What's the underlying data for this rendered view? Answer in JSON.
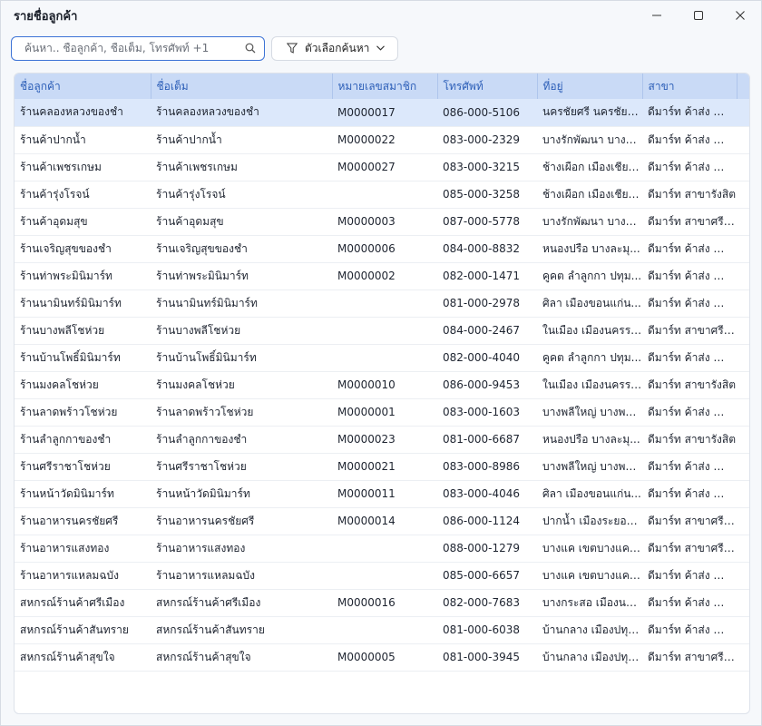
{
  "window": {
    "title": "รายชื่อลูกค้า",
    "controls": {
      "minimize": "—",
      "maximize": "☐",
      "close": "✕"
    }
  },
  "search": {
    "placeholder": "ค้นหา.. ชื่อลูกค้า, ชื่อเต็ม, โทรศัพท์ +1",
    "value": "",
    "icon": "search-icon"
  },
  "filter": {
    "label": "ตัวเลือกค้นหา",
    "icon": "funnel-icon",
    "chevron": "chevron-down-icon"
  },
  "colors": {
    "accent": "#3d73d6",
    "header_bg": "#c9daf6",
    "header_text": "#2d5fb8",
    "selected_row": "#dce8fb"
  },
  "table": {
    "columns": [
      "ชื่อลูกค้า",
      "ชื่อเต็ม",
      "หมายเลขสมาชิก",
      "โทรศัพท์",
      "ที่อยู่",
      "สาขา"
    ],
    "selected_index": 0,
    "rows": [
      [
        "ร้านคลองหลวงของชำ",
        "ร้านคลองหลวงของชำ",
        "M0000017",
        "086-000-5106",
        "นครชัยศรี นครชัยศ...",
        "ดีมาร์ท ค้าส่ง สำนั..."
      ],
      [
        "ร้านค้าปากน้ำ",
        "ร้านค้าปากน้ำ",
        "M0000022",
        "083-000-2329",
        "บางรักพัฒนา บางบั...",
        "ดีมาร์ท ค้าส่ง สำนั..."
      ],
      [
        "ร้านค้าเพชรเกษม",
        "ร้านค้าเพชรเกษม",
        "M0000027",
        "083-000-3215",
        "ช้างเผือก เมืองเชียงใ...",
        "ดีมาร์ท ค้าส่ง สำนั..."
      ],
      [
        "ร้านค้ารุ่งโรจน์",
        "ร้านค้ารุ่งโรจน์",
        "",
        "085-000-3258",
        "ช้างเผือก เมืองเชียงใ...",
        "ดีมาร์ท สาขารังสิต"
      ],
      [
        "ร้านค้าอุดมสุข",
        "ร้านค้าอุดมสุข",
        "M0000003",
        "087-000-5778",
        "บางรักพัฒนา บางบั...",
        "ดีมาร์ท สาขาศรีร..."
      ],
      [
        "ร้านเจริญสุขของชำ",
        "ร้านเจริญสุขของชำ",
        "M0000006",
        "084-000-8832",
        "หนองปรือ บางละมุ...",
        "ดีมาร์ท ค้าส่ง สำนั..."
      ],
      [
        "ร้านท่าพระมินิมาร์ท",
        "ร้านท่าพระมินิมาร์ท",
        "M0000002",
        "082-000-1471",
        "คูคต ลำลูกกา ปทุม...",
        "ดีมาร์ท ค้าส่ง สำนั..."
      ],
      [
        "ร้านนามินทร์มินิมาร์ท",
        "ร้านนามินทร์มินิมาร์ท",
        "",
        "081-000-2978",
        "ศิลา เมืองขอนแก่น...",
        "ดีมาร์ท ค้าส่ง สำนั..."
      ],
      [
        "ร้านบางพลีโชห่วย",
        "ร้านบางพลีโชห่วย",
        "",
        "084-000-2467",
        "ในเมือง เมืองนครรา...",
        "ดีมาร์ท สาขาศรีร..."
      ],
      [
        "ร้านบ้านโพธิ์มินิมาร์ท",
        "ร้านบ้านโพธิ์มินิมาร์ท",
        "",
        "082-000-4040",
        "คูคต ลำลูกกา ปทุม...",
        "ดีมาร์ท ค้าส่ง สำนั..."
      ],
      [
        "ร้านมงคลโชห่วย",
        "ร้านมงคลโชห่วย",
        "M0000010",
        "086-000-9453",
        "ในเมือง เมืองนครรา...",
        "ดีมาร์ท สาขารังสิต"
      ],
      [
        "ร้านลาดพร้าวโชห่วย",
        "ร้านลาดพร้าวโชห่วย",
        "M0000001",
        "083-000-1603",
        "บางพลีใหญ่ บางพลี...",
        "ดีมาร์ท ค้าส่ง สำนั..."
      ],
      [
        "ร้านลำลูกกาของชำ",
        "ร้านลำลูกกาของชำ",
        "M0000023",
        "081-000-6687",
        "หนองปรือ บางละมุ...",
        "ดีมาร์ท สาขารังสิต"
      ],
      [
        "ร้านศรีราชาโชห่วย",
        "ร้านศรีราชาโชห่วย",
        "M0000021",
        "083-000-8986",
        "บางพลีใหญ่ บางพลี...",
        "ดีมาร์ท ค้าส่ง สำนั..."
      ],
      [
        "ร้านหน้าวัดมินิมาร์ท",
        "ร้านหน้าวัดมินิมาร์ท",
        "M0000011",
        "083-000-4046",
        "ศิลา เมืองขอนแก่น...",
        "ดีมาร์ท ค้าส่ง สำนั..."
      ],
      [
        "ร้านอาหารนครชัยศรี",
        "ร้านอาหารนครชัยศรี",
        "M0000014",
        "086-000-1124",
        "ปากน้ำ เมืองระยอง ร...",
        "ดีมาร์ท สาขาศรีร..."
      ],
      [
        "ร้านอาหารแสงทอง",
        "ร้านอาหารแสงทอง",
        "",
        "088-000-1279",
        "บางแค เขตบางแค ก...",
        "ดีมาร์ท สาขาศรีร..."
      ],
      [
        "ร้านอาหารแหลมฉบัง",
        "ร้านอาหารแหลมฉบัง",
        "",
        "085-000-6657",
        "บางแค เขตบางแค ก...",
        "ดีมาร์ท ค้าส่ง สำนั..."
      ],
      [
        "สหกรณ์ร้านค้าศรีเมือง",
        "สหกรณ์ร้านค้าศรีเมือง",
        "M0000016",
        "082-000-7683",
        "บางกระสอ เมืองนนท...",
        "ดีมาร์ท ค้าส่ง สำนั..."
      ],
      [
        "สหกรณ์ร้านค้าสันทราย",
        "สหกรณ์ร้านค้าสันทราย",
        "",
        "081-000-6038",
        "บ้านกลาง เมืองปทุม...",
        "ดีมาร์ท ค้าส่ง สำนั..."
      ],
      [
        "สหกรณ์ร้านค้าสุขใจ",
        "สหกรณ์ร้านค้าสุขใจ",
        "M0000005",
        "081-000-3945",
        "บ้านกลาง เมืองปทุม...",
        "ดีมาร์ท สาขาศรีร..."
      ]
    ]
  }
}
